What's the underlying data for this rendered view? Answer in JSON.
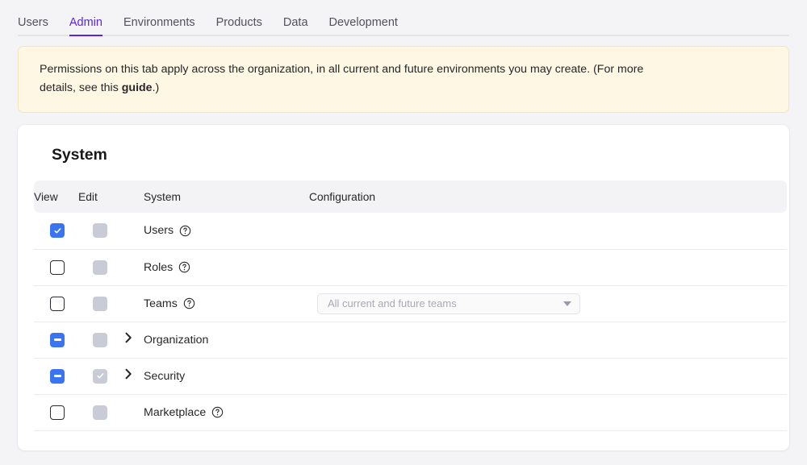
{
  "tabs": [
    {
      "label": "Users",
      "active": false
    },
    {
      "label": "Admin",
      "active": true
    },
    {
      "label": "Environments",
      "active": false
    },
    {
      "label": "Products",
      "active": false
    },
    {
      "label": "Data",
      "active": false
    },
    {
      "label": "Development",
      "active": false
    }
  ],
  "notice": {
    "text_before": "Permissions on this tab apply across the organization, in all current and future environments you may create. (For more details, see this ",
    "link_label": "guide",
    "text_after": ".)"
  },
  "card": {
    "title": "System",
    "columns": {
      "view": "View",
      "edit": "Edit",
      "system": "System",
      "configuration": "Configuration"
    },
    "rows": [
      {
        "label": "Users",
        "view_state": "checked",
        "edit_state": "disabled",
        "has_help": true,
        "expandable": false,
        "config": null
      },
      {
        "label": "Roles",
        "view_state": "unchecked",
        "edit_state": "disabled",
        "has_help": true,
        "expandable": false,
        "config": null
      },
      {
        "label": "Teams",
        "view_state": "unchecked",
        "edit_state": "disabled",
        "has_help": true,
        "expandable": false,
        "config": {
          "type": "select",
          "value": "All current and future teams"
        }
      },
      {
        "label": "Organization",
        "view_state": "indeterminate",
        "edit_state": "disabled",
        "has_help": false,
        "expandable": true,
        "config": null
      },
      {
        "label": "Security",
        "view_state": "indeterminate",
        "edit_state": "disabled-checked",
        "has_help": false,
        "expandable": true,
        "config": null
      },
      {
        "label": "Marketplace",
        "view_state": "unchecked",
        "edit_state": "disabled",
        "has_help": true,
        "expandable": false,
        "config": null
      }
    ]
  },
  "colors": {
    "accent": "#5b21f0",
    "checkbox_active": "#3b74f2",
    "checkbox_disabled": "#c9cbd6",
    "notice_bg": "#fdf7e3",
    "notice_border": "#f3e6bd",
    "page_bg": "#f4f4f6"
  }
}
